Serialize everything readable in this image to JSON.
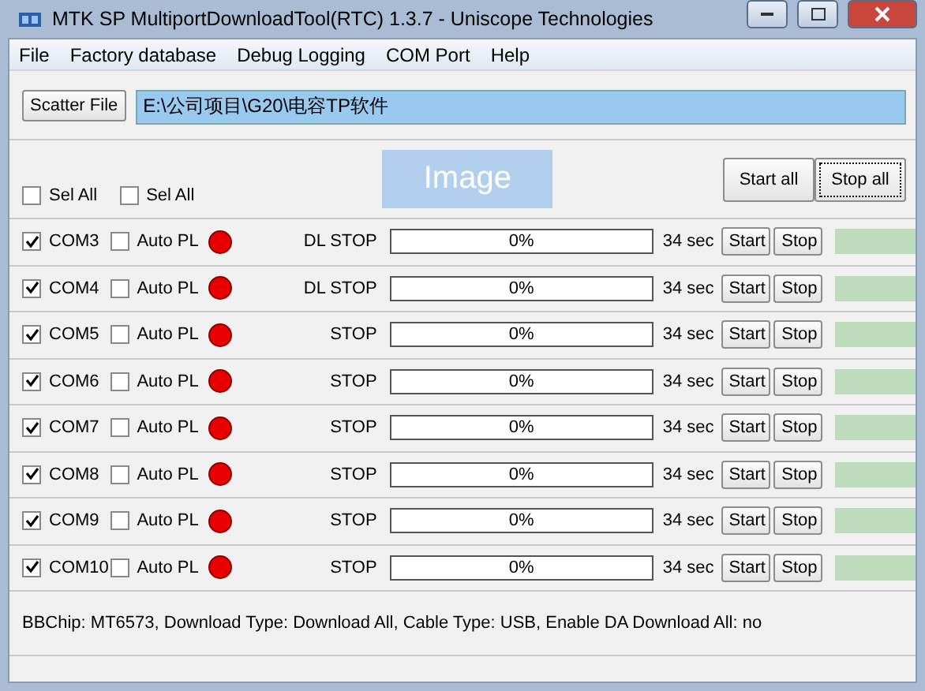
{
  "window": {
    "title": "MTK SP MultiportDownloadTool(RTC) 1.3.7 - Uniscope Technologies"
  },
  "menu": [
    "File",
    "Factory database",
    "Debug Logging",
    "COM Port",
    "Help"
  ],
  "scatter": {
    "button": "Scatter File",
    "path": "E:\\公司项目\\G20\\电容TP软件"
  },
  "sel_all": [
    {
      "label": "Sel All",
      "checked": false
    },
    {
      "label": "Sel All",
      "checked": false
    }
  ],
  "image_button": "Image",
  "actions": [
    "Start all",
    "Stop all"
  ],
  "ports": [
    {
      "name": "COM3",
      "checked": true,
      "auto_pl": {
        "label": "Auto PL",
        "checked": false
      },
      "status": "DL STOP",
      "progress": "0%",
      "level": 0,
      "time": "34 sec",
      "buttons": [
        "Start",
        "Stop"
      ]
    },
    {
      "name": "COM4",
      "checked": true,
      "auto_pl": {
        "label": "Auto PL",
        "checked": false
      },
      "status": "DL STOP",
      "progress": "0%",
      "level": 0,
      "time": "34 sec",
      "buttons": [
        "Start",
        "Stop"
      ]
    },
    {
      "name": "COM5",
      "checked": true,
      "auto_pl": {
        "label": "Auto PL",
        "checked": false
      },
      "status": "STOP",
      "progress": "0%",
      "level": 0,
      "time": "34 sec",
      "buttons": [
        "Start",
        "Stop"
      ]
    },
    {
      "name": "COM6",
      "checked": true,
      "auto_pl": {
        "label": "Auto PL",
        "checked": false
      },
      "status": "STOP",
      "progress": "0%",
      "level": 0,
      "time": "34 sec",
      "buttons": [
        "Start",
        "Stop"
      ]
    },
    {
      "name": "COM7",
      "checked": true,
      "auto_pl": {
        "label": "Auto PL",
        "checked": false
      },
      "status": "STOP",
      "progress": "0%",
      "level": 0,
      "time": "34 sec",
      "buttons": [
        "Start",
        "Stop"
      ]
    },
    {
      "name": "COM8",
      "checked": true,
      "auto_pl": {
        "label": "Auto PL",
        "checked": false
      },
      "status": "STOP",
      "progress": "0%",
      "level": 0,
      "time": "34 sec",
      "buttons": [
        "Start",
        "Stop"
      ]
    },
    {
      "name": "COM9",
      "checked": true,
      "auto_pl": {
        "label": "Auto PL",
        "checked": false
      },
      "status": "STOP",
      "progress": "0%",
      "level": 0,
      "time": "34 sec",
      "buttons": [
        "Start",
        "Stop"
      ]
    },
    {
      "name": "COM10",
      "checked": true,
      "auto_pl": {
        "label": "Auto PL",
        "checked": false
      },
      "status": "STOP",
      "progress": "0%",
      "level": 0,
      "time": "34 sec",
      "buttons": [
        "Start",
        "Stop"
      ]
    }
  ],
  "status_line": "BBChip: MT6573,  Download Type: Download All,  Cable Type: USB,  Enable DA Download All: no"
}
